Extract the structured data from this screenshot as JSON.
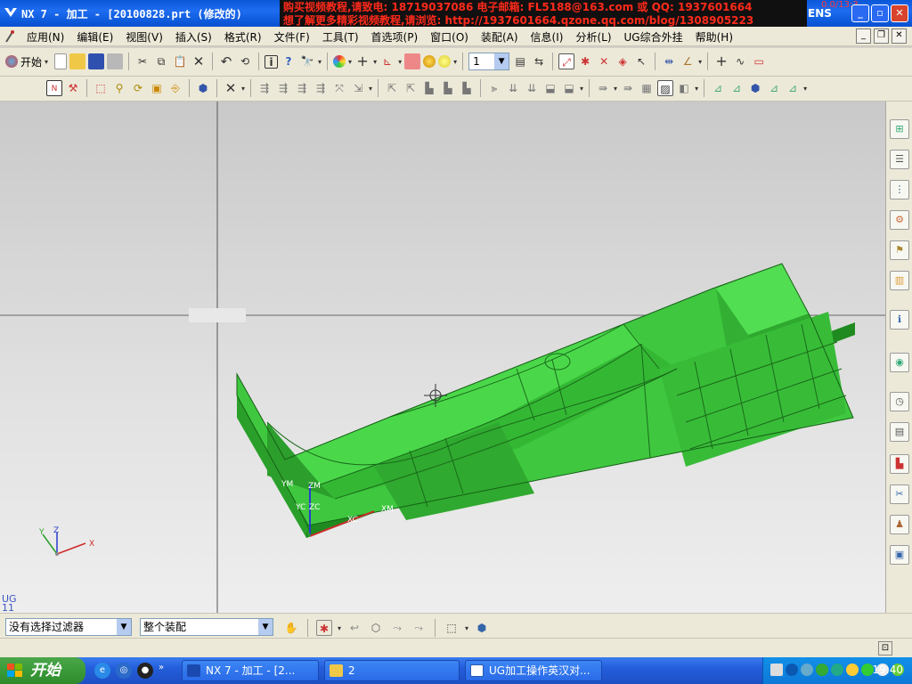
{
  "window": {
    "title": "NX 7 - 加工 - [20100828.prt (修改的)",
    "brand": "ENS",
    "coord_readout": "0.0/13:3"
  },
  "banner": {
    "line1": "购买视频教程,请致电: 18719037086  电子邮箱: FL5188@163.com 或 QQ: 1937601664",
    "line2": "想了解更多精彩视频教程,请浏览: http://1937601664.qzone.qq.com/blog/1308905223"
  },
  "menu": {
    "items": [
      {
        "label": "应用(N)"
      },
      {
        "label": "编辑(E)"
      },
      {
        "label": "视图(V)"
      },
      {
        "label": "插入(S)"
      },
      {
        "label": "格式(R)"
      },
      {
        "label": "文件(F)"
      },
      {
        "label": "工具(T)"
      },
      {
        "label": "首选项(P)"
      },
      {
        "label": "窗口(O)"
      },
      {
        "label": "装配(A)"
      },
      {
        "label": "信息(I)"
      },
      {
        "label": "分析(L)"
      },
      {
        "label": "UG综合外挂"
      },
      {
        "label": "帮助(H)"
      }
    ]
  },
  "toolbar": {
    "start_label": "开始",
    "layer_value": "1"
  },
  "viewport": {
    "ug_label_line1": "UG",
    "ug_label_line2": "11",
    "wcs_labels": {
      "ym": "YM",
      "zm": "ZM",
      "yc": "YC",
      "zc": "ZC",
      "xc": "XC",
      "xm": "XM"
    },
    "triad_labels": {
      "x": "X",
      "y": "Y",
      "z": "Z"
    },
    "model_color": "#3fc83f"
  },
  "selection": {
    "filter_value": "没有选择过滤器",
    "scope_value": "整个装配"
  },
  "taskbar": {
    "start_label": "开始",
    "tasks": [
      {
        "label": "NX 7 - 加工 - [2..."
      },
      {
        "label": "2"
      },
      {
        "label": "UG加工操作英汉对..."
      }
    ],
    "clock": "19:40"
  }
}
